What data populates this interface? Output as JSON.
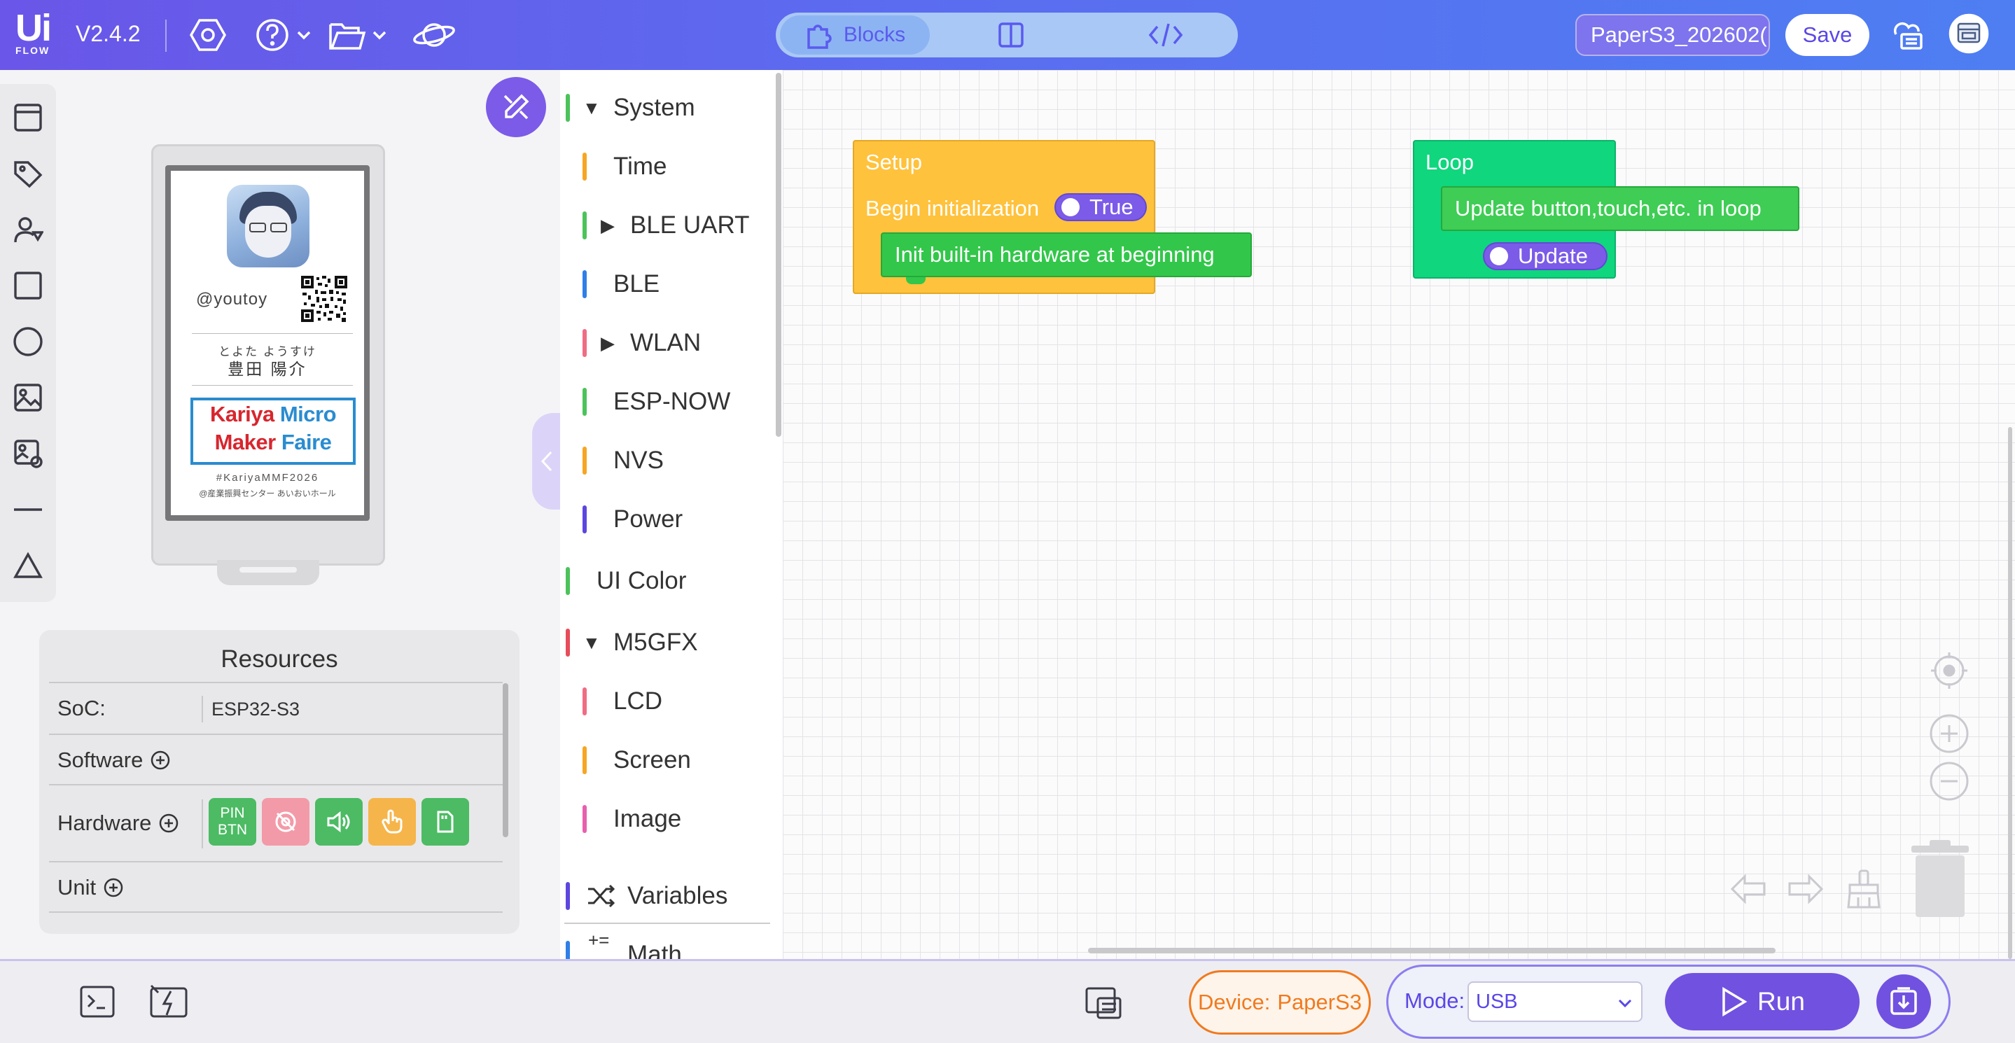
{
  "topbar": {
    "logo_text": "Ui",
    "logo_sub": "FLOW",
    "version": "V2.4.2",
    "mode_tabs": {
      "blocks_label": "Blocks"
    },
    "filename": "PaperS3_202602(",
    "save_label": "Save"
  },
  "device_preview": {
    "handle": "@youtoy",
    "name_kana": "とよた ようすけ",
    "name_kanji": "豊田 陽介",
    "logo_line1_a": "Kariya",
    "logo_line1_b": "Micro",
    "logo_line2_a": "Maker",
    "logo_line2_b": "Faire",
    "hashtag": "#KariyaMMF2026",
    "venue": "@産業振興センター あいおいホール"
  },
  "resources": {
    "title": "Resources",
    "soc_label": "SoC:",
    "soc_value": "ESP32-S3",
    "software_label": "Software",
    "hardware_label": "Hardware",
    "unit_label": "Unit",
    "hardware_chips": [
      {
        "label": "PIN BTN",
        "color": "#4cbb64"
      },
      {
        "label": "",
        "color": "#f39aa8"
      },
      {
        "label": "",
        "color": "#4cbb64"
      },
      {
        "label": "",
        "color": "#f6b54a"
      },
      {
        "label": "",
        "color": "#4cbb64"
      }
    ]
  },
  "toolbox": {
    "categories": [
      {
        "label": "System",
        "color": "#4cc35a",
        "expanded": true
      },
      {
        "label": "Time",
        "color": "#f6a623"
      },
      {
        "label": "BLE UART",
        "color": "#4cc35a",
        "collapsed": true
      },
      {
        "label": "BLE",
        "color": "#2f7fe6"
      },
      {
        "label": "WLAN",
        "color": "#f06c84",
        "collapsed": true
      },
      {
        "label": "ESP-NOW",
        "color": "#4cc35a"
      },
      {
        "label": "NVS",
        "color": "#f6a623"
      },
      {
        "label": "Power",
        "color": "#5b47e0"
      },
      {
        "label": "UI Color",
        "color": "#4cc35a"
      },
      {
        "label": "M5GFX",
        "color": "#e84c5a",
        "expanded": true
      },
      {
        "label": "LCD",
        "color": "#f06c84"
      },
      {
        "label": "Screen",
        "color": "#f6a623"
      },
      {
        "label": "Image",
        "color": "#e85fae"
      },
      {
        "label": "Variables",
        "color": "#5b47e0"
      },
      {
        "label": "Math",
        "color": "#2f7fe6"
      }
    ]
  },
  "workspace": {
    "setup": {
      "title": "Setup",
      "begin_label": "Begin initialization",
      "begin_value": "True",
      "init_label": "Init built-in hardware at beginning",
      "color": "#ffc23c"
    },
    "loop": {
      "title": "Loop",
      "update_label": "Update button,touch,etc. in loop",
      "update_value": "Update",
      "color": "#10d67e"
    }
  },
  "bottombar": {
    "device_prefix": "Device:",
    "device_name": "PaperS3",
    "mode_label": "Mode:",
    "mode_value": "USB",
    "run_label": "Run"
  },
  "colors": {
    "accent": "#7151e0",
    "topbar_start": "#6a56e8",
    "topbar_end": "#4e7ef2",
    "device_orange": "#f07a1e"
  }
}
